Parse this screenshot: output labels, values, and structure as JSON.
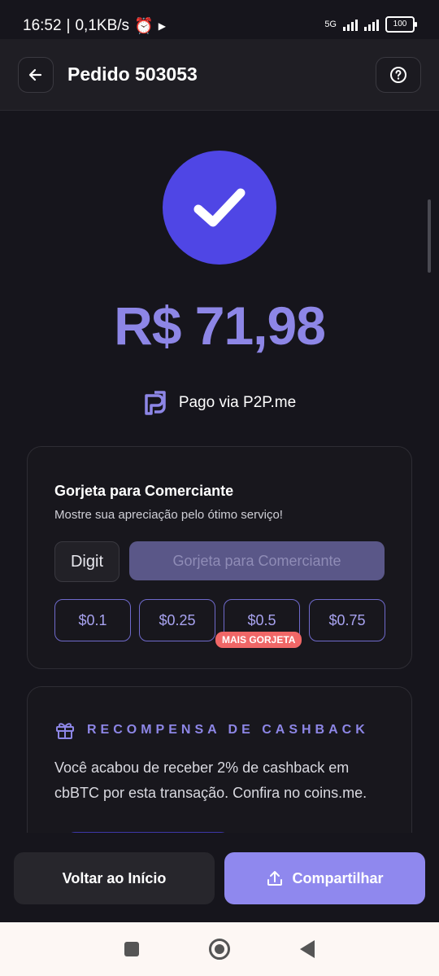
{
  "status_bar": {
    "time": "16:52",
    "speed": "0,1KB/s",
    "network": "5G",
    "battery": "100"
  },
  "header": {
    "title": "Pedido 503053",
    "back_icon": "arrow-left-icon",
    "help_icon": "question-circle-icon"
  },
  "payment": {
    "amount": "R$ 71,98",
    "paid_via": "Pago via P2P.me",
    "status_icon": "check-icon",
    "accent_color": "#4f46e5"
  },
  "tip": {
    "title": "Gorjeta para Comerciante",
    "subtitle": "Mostre sua apreciação pelo ótimo serviço!",
    "digit_label": "Digit",
    "button_label": "Gorjeta para Comerciante",
    "options": [
      "$0.1",
      "$0.25",
      "$0.5",
      "$0.75"
    ],
    "badge": "MAIS GORJETA"
  },
  "cashback": {
    "title": "RECOMPENSA DE CASHBACK",
    "icon": "gift-icon",
    "text": "Você acabou de receber 2% de cashback em cbBTC por esta transação. Confira no coins.me."
  },
  "actions": {
    "home_label": "Voltar ao Início",
    "share_label": "Compartilhar",
    "share_color": "#8f88ee"
  }
}
